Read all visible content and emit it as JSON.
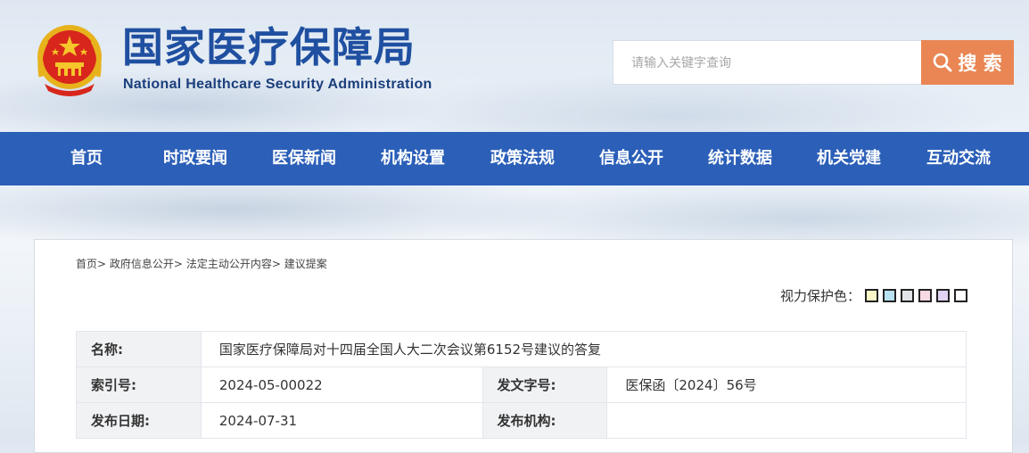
{
  "header": {
    "title_cn": "国家医疗保障局",
    "title_en": "National Healthcare Security Administration",
    "emblem_icon": "national-emblem-icon"
  },
  "search": {
    "placeholder": "请输入关键字查询",
    "button_label": "搜 索",
    "button_color": "#e98653"
  },
  "nav": {
    "color": "#2b5fb8",
    "items": [
      {
        "label": "首页"
      },
      {
        "label": "时政要闻"
      },
      {
        "label": "医保新闻"
      },
      {
        "label": "机构设置"
      },
      {
        "label": "政策法规"
      },
      {
        "label": "信息公开"
      },
      {
        "label": "统计数据"
      },
      {
        "label": "机关党建"
      },
      {
        "label": "互动交流"
      }
    ]
  },
  "breadcrumb": {
    "items": [
      "首页",
      "政府信息公开",
      "法定主动公开内容",
      "建议提案"
    ],
    "separator": ">"
  },
  "vision_protect": {
    "label": "视力保护色：",
    "colors": [
      "#faf6c8",
      "#b8e2f2",
      "#e2e4e8",
      "#f7d9e3",
      "#e1d3f3",
      "#ffffff"
    ]
  },
  "info": {
    "name_label": "名称:",
    "name_value": "国家医疗保障局对十四届全国人大二次会议第6152号建议的答复",
    "index_label": "索引号:",
    "index_value": "2024-05-00022",
    "docnum_label": "发文字号:",
    "docnum_value": "医保函〔2024〕56号",
    "date_label": "发布日期:",
    "date_value": "2024-07-31",
    "org_label": "发布机构:",
    "org_value": ""
  }
}
